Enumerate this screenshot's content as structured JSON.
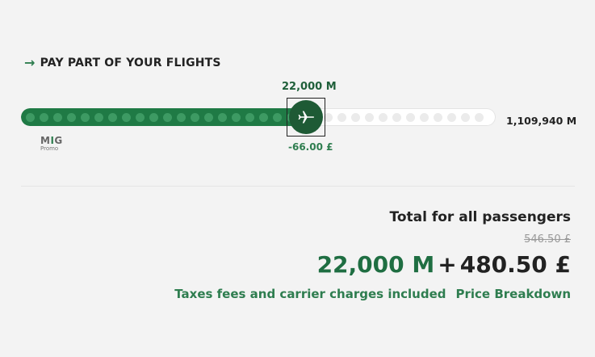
{
  "section": {
    "title": "PAY PART OF YOUR FLIGHTS",
    "arrow_icon": "arrow-right-icon"
  },
  "slider": {
    "selected_miles": "22,000 M",
    "max_miles": "1,109,940 M",
    "discount": "-66.00 £",
    "progress_fraction": 0.6,
    "fill_color": "#1f7a45",
    "handle_color": "#1e5a35",
    "handle_icon": "airplane-icon"
  },
  "promo_logo": {
    "brand_text": "MIG",
    "sub_text": "Promo"
  },
  "totals": {
    "label": "Total for all passengers",
    "old_price": "546.50 £",
    "miles_price": "22,000 M",
    "plus": "+",
    "cash_price": "480.50 £",
    "taxes_note": "Taxes fees and carrier charges included",
    "price_breakdown_link": "Price Breakdown",
    "accent_color": "#2e7d4f"
  }
}
